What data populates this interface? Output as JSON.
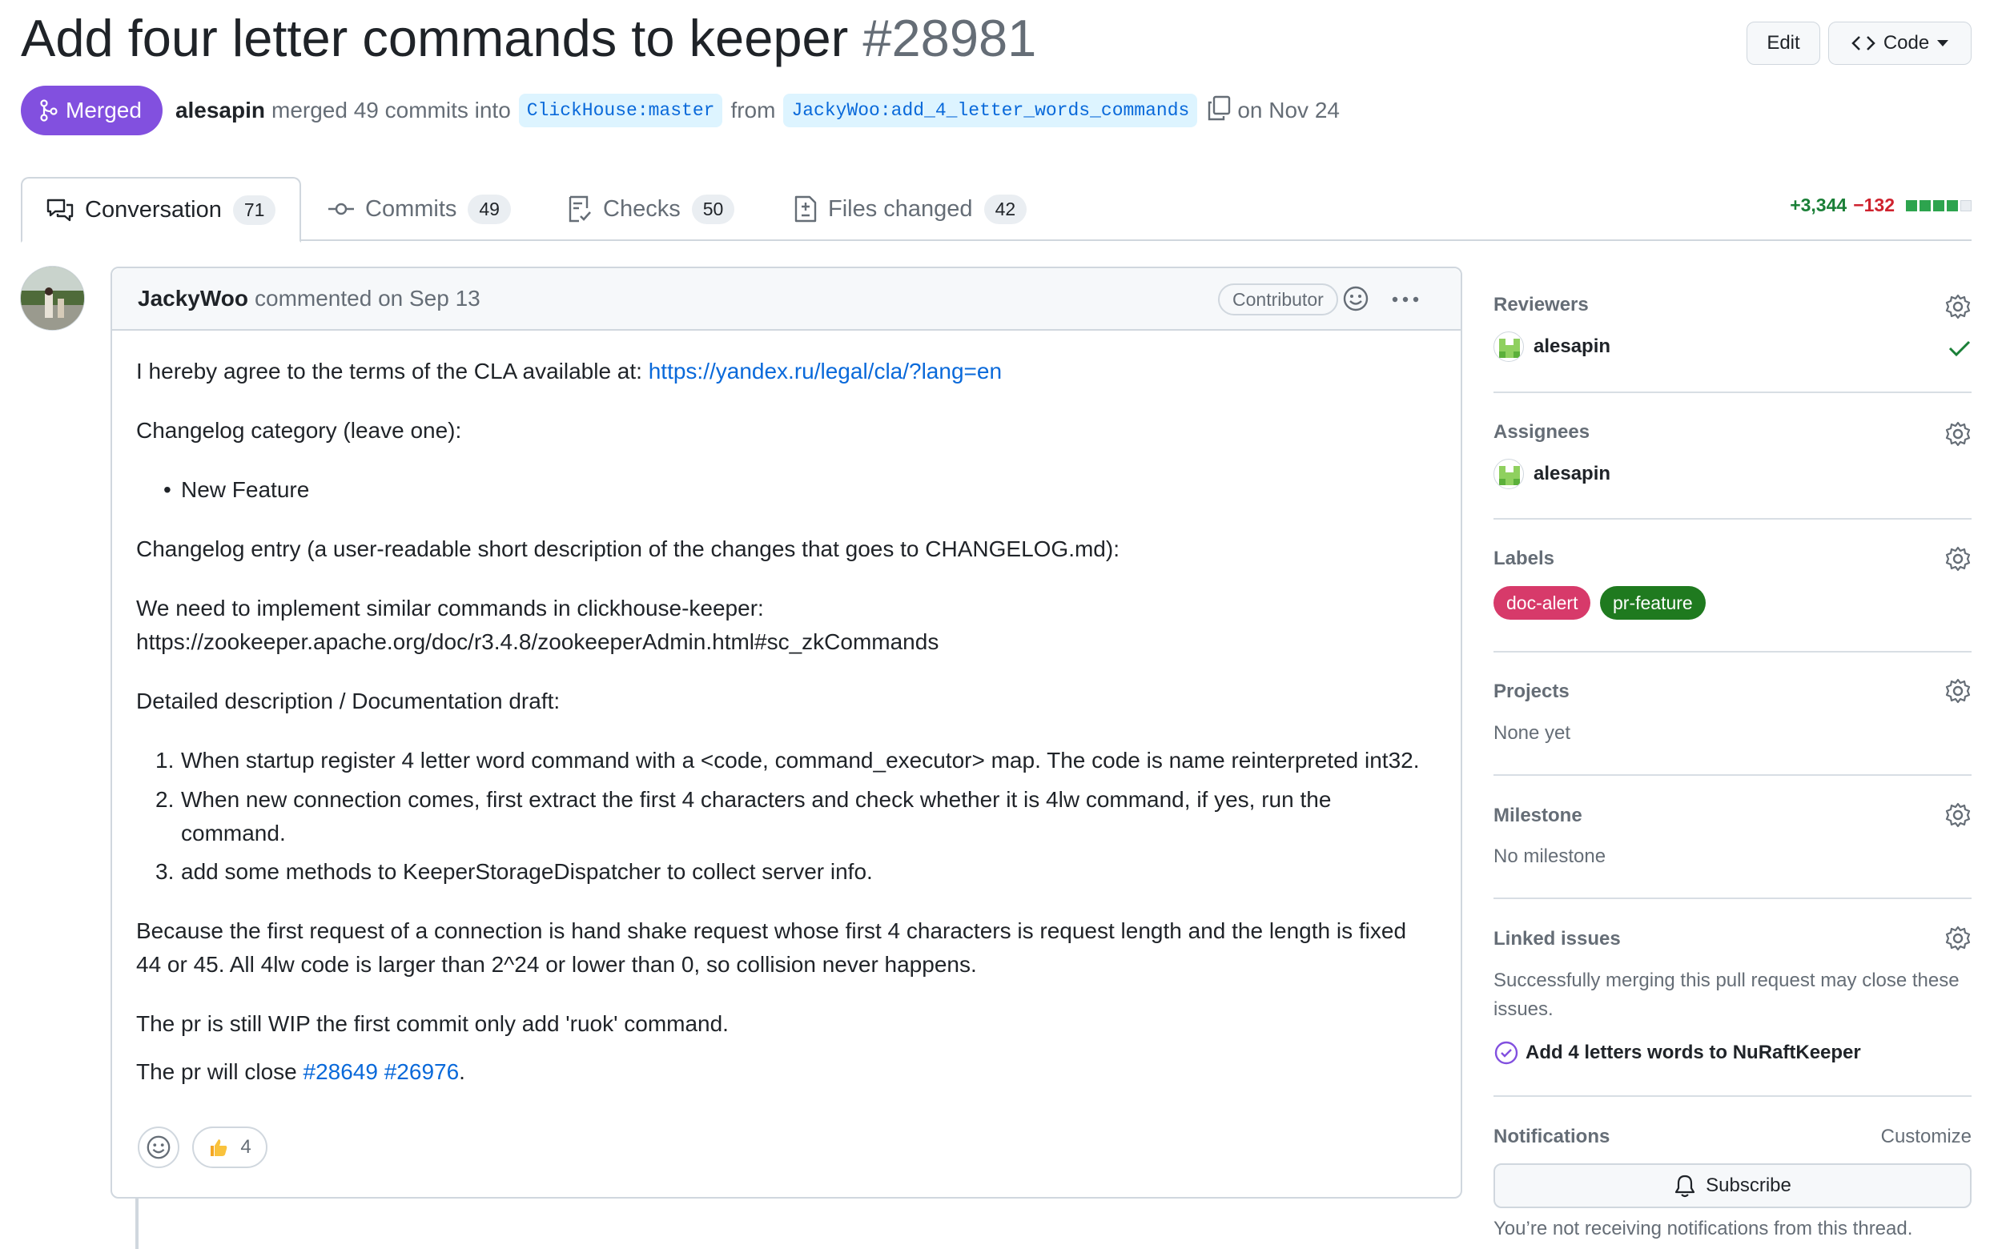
{
  "pr": {
    "title": "Add four letter commands to keeper",
    "number": "#28981",
    "status": "Merged",
    "author": "alesapin",
    "merge_text": "merged 49 commits into",
    "base_branch": "ClickHouse:master",
    "from_text": "from",
    "head_branch": "JackyWoo:add_4_letter_words_commands",
    "date_text": "on Nov 24"
  },
  "header_buttons": {
    "edit": "Edit",
    "code": "Code"
  },
  "tabs": [
    {
      "label": "Conversation",
      "count": "71"
    },
    {
      "label": "Commits",
      "count": "49"
    },
    {
      "label": "Checks",
      "count": "50"
    },
    {
      "label": "Files changed",
      "count": "42"
    }
  ],
  "diffstat": {
    "additions": "+3,344",
    "deletions": "−132",
    "blocks": [
      "#2da44e",
      "#2da44e",
      "#2da44e",
      "#2da44e",
      "#eaeef2"
    ]
  },
  "comment": {
    "author": "JackyWoo",
    "action": "commented on Sep 13",
    "badge": "Contributor",
    "cla_text": "I hereby agree to the terms of the CLA available at:",
    "cla_link": "https://yandex.ru/legal/cla/?lang=en",
    "changelog_category": "Changelog category (leave one):",
    "category_item": "New Feature",
    "changelog_entry": "Changelog entry (a user-readable short description of the changes that goes to CHANGELOG.md):",
    "need_text": "We need to implement similar commands in clickhouse-keeper:",
    "zk_link": "https://zookeeper.apache.org/doc/r3.4.8/zookeeperAdmin.html#sc_zkCommands",
    "detailed": "Detailed description / Documentation draft:",
    "steps": [
      "When startup register 4 letter word command with a <code, command_executor> map. The code is name reinterpreted int32.",
      "When new connection comes, first extract the first 4 characters and check whether it is 4lw command, if yes, run the",
      "command.",
      "add some methods to KeeperStorageDispatcher to collect server info."
    ],
    "because_1": "Because the first request of a connection is hand shake request whose first 4 characters is request length and the length is fixed",
    "because_2": "44 or 45. All 4lw code is larger than 2^24 or lower than 0, so collision never happens.",
    "wip": "The pr is still WIP the first commit only add 'ruok' command.",
    "close_text": "The pr will close",
    "issue_1": "#28649",
    "issue_2": "#26976",
    "close_end": ".",
    "thumbs_count": "4"
  },
  "sidebar": {
    "reviewers_title": "Reviewers",
    "reviewer": "alesapin",
    "assignees_title": "Assignees",
    "assignee": "alesapin",
    "labels_title": "Labels",
    "labels": [
      {
        "name": "doc-alert",
        "color": "#d73a6a"
      },
      {
        "name": "pr-feature",
        "color": "#1f7a1f"
      }
    ],
    "projects_title": "Projects",
    "projects_value": "None yet",
    "milestone_title": "Milestone",
    "milestone_value": "No milestone",
    "linked_title": "Linked issues",
    "linked_desc_1": "Successfully merging this pull request may close these",
    "linked_desc_2": "issues.",
    "linked_issue": "Add 4 letters words to NuRaftKeeper",
    "notifications_title": "Notifications",
    "customize": "Customize",
    "subscribe": "Subscribe",
    "not_receiving": "You’re not receiving notifications from this thread."
  },
  "colors": {
    "merged": "#8250df",
    "link": "#0969da",
    "green": "#1a7f37",
    "red": "#cf222e"
  },
  "icons": [
    "git-merge-icon",
    "copy-icon",
    "code-icon",
    "comment-discussion-icon",
    "git-commit-icon",
    "checklist-icon",
    "file-diff-icon",
    "smiley-icon",
    "kebab-icon",
    "gear-icon",
    "check-icon",
    "issue-closed-icon",
    "bell-icon",
    "thumbs-up-icon"
  ]
}
